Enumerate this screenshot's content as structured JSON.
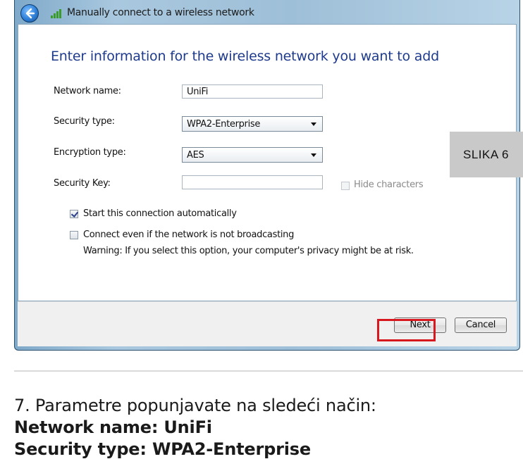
{
  "window": {
    "title": "Manually connect to a wireless network",
    "heading": "Enter information for the wireless network you want to add",
    "icons": {
      "back": "back-arrow-icon",
      "network": "wireless-signal-icon"
    }
  },
  "form": {
    "network_name": {
      "label": "Network name:",
      "value": "UniFi"
    },
    "security_type": {
      "label": "Security type:",
      "value": "WPA2-Enterprise"
    },
    "encryption_type": {
      "label": "Encryption type:",
      "value": "AES"
    },
    "security_key": {
      "label": "Security Key:",
      "value": ""
    },
    "hide_characters": {
      "label": "Hide characters",
      "checked": false,
      "disabled": true
    },
    "start_auto": {
      "label": "Start this connection automatically",
      "checked": true
    },
    "connect_hidden": {
      "label": "Connect even if the network is not broadcasting",
      "checked": false
    },
    "warning": "Warning: If you select this option, your computer's privacy might be at risk."
  },
  "buttons": {
    "next": "Next",
    "cancel": "Cancel"
  },
  "badge": "SLIKA 6",
  "article": {
    "step": "7. Parametre popunjavate na sledeći način:",
    "line1": "Network name: UniFi",
    "line2": "Security type: WPA2-Enterprise"
  },
  "colors": {
    "heading": "#1e3a8c",
    "highlight": "#d8181f",
    "badge_bg": "#c9c9c9"
  }
}
